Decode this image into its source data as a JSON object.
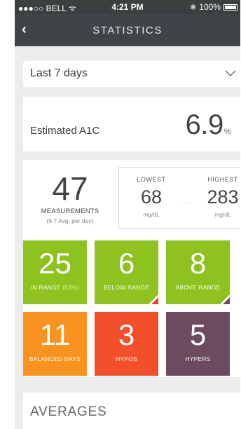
{
  "status_bar": {
    "carrier": "●●●○○ BELL",
    "wifi": "ᯤ",
    "time": "4:21 PM",
    "bluetooth": "✱",
    "battery": "100%"
  },
  "nav": {
    "back_glyph": "‹",
    "title": "STATISTICS"
  },
  "period": {
    "selected": "Last 7 days"
  },
  "a1c": {
    "label": "Estimated A1C",
    "value": "6.9",
    "unit": "%"
  },
  "measurements": {
    "count": "47",
    "label": "MEASUREMENTS",
    "avg": "(6.7 Avg. per day)"
  },
  "range": {
    "lowest_label": "LOWEST",
    "lowest_value": "68",
    "lowest_unit": "mg/dL",
    "dots": "···",
    "highest_label": "HIGHEST",
    "highest_value": "283",
    "highest_unit": "mg/dL"
  },
  "tiles": {
    "in_range": {
      "value": "25",
      "label_main": "IN RANGE ",
      "label_pct": "(53%)",
      "color": "#8dc21f"
    },
    "below_range": {
      "value": "6",
      "label": "BELOW RANGE",
      "color": "#8dc21f"
    },
    "above_range": {
      "value": "8",
      "label": "ABOVE RANGE",
      "color": "#8dc21f"
    },
    "balanced_days": {
      "value": "11",
      "label": "BALANCED DAYS",
      "color": "#f7931e"
    },
    "hypos": {
      "value": "3",
      "label": "HYPOS",
      "color": "#f24f2a"
    },
    "hypers": {
      "value": "5",
      "label": "HYPERS",
      "color": "#6d4b5e"
    }
  },
  "averages": {
    "title": "AVERAGES"
  }
}
